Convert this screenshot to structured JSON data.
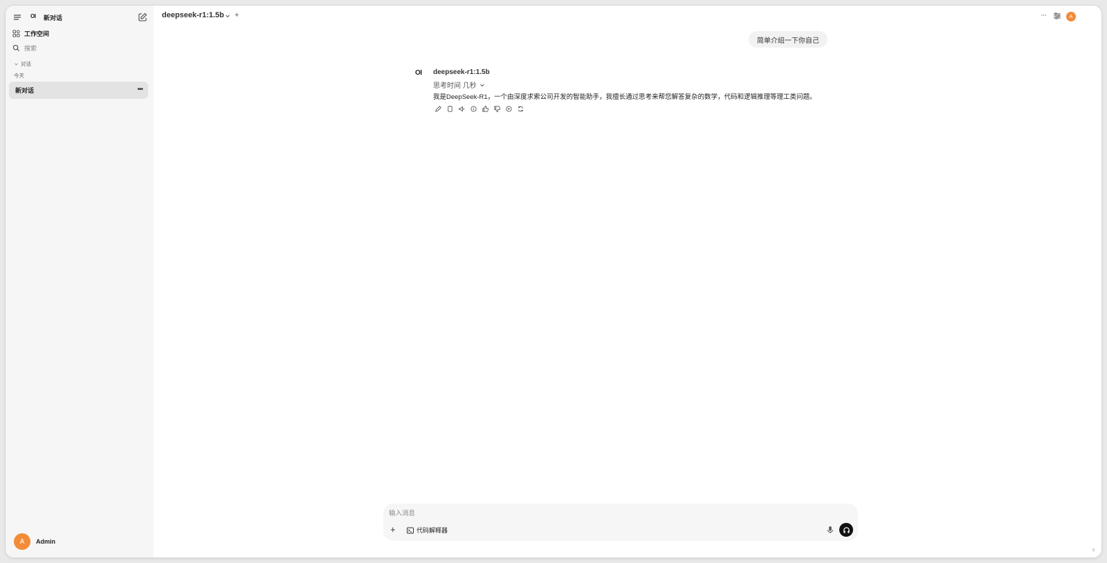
{
  "sidebar": {
    "logo": "OI",
    "new_chat_label": "新对话",
    "workspace_label": "工作空间",
    "search_placeholder": "搜索",
    "section_label": "对话",
    "group_today": "今天",
    "chats": [
      {
        "title": "新对话"
      }
    ],
    "user_initial": "A",
    "user_name": "Admin"
  },
  "header": {
    "model": "deepseek-r1:1.5b",
    "add_symbol": "+",
    "avatar_initial": "A"
  },
  "conversation": {
    "user_message": "简单介绍一下你自己",
    "assistant_logo": "OI",
    "assistant_model": "deepseek-r1:1.5b",
    "thinking_label": "思考时间 几秒",
    "assistant_message": "我是DeepSeek-R1，一个由深度求索公司开发的智能助手，我擅长通过思考来帮您解答复杂的数学，代码和逻辑推理等理工类问题。"
  },
  "composer": {
    "placeholder": "输入消息",
    "code_interpreter_label": "代码解释器",
    "add_symbol": "+"
  },
  "colors": {
    "accent": "#f28c38",
    "sidebar_bg": "#f6f6f6",
    "selected_bg": "#e3e3e3"
  },
  "help_label": "?"
}
